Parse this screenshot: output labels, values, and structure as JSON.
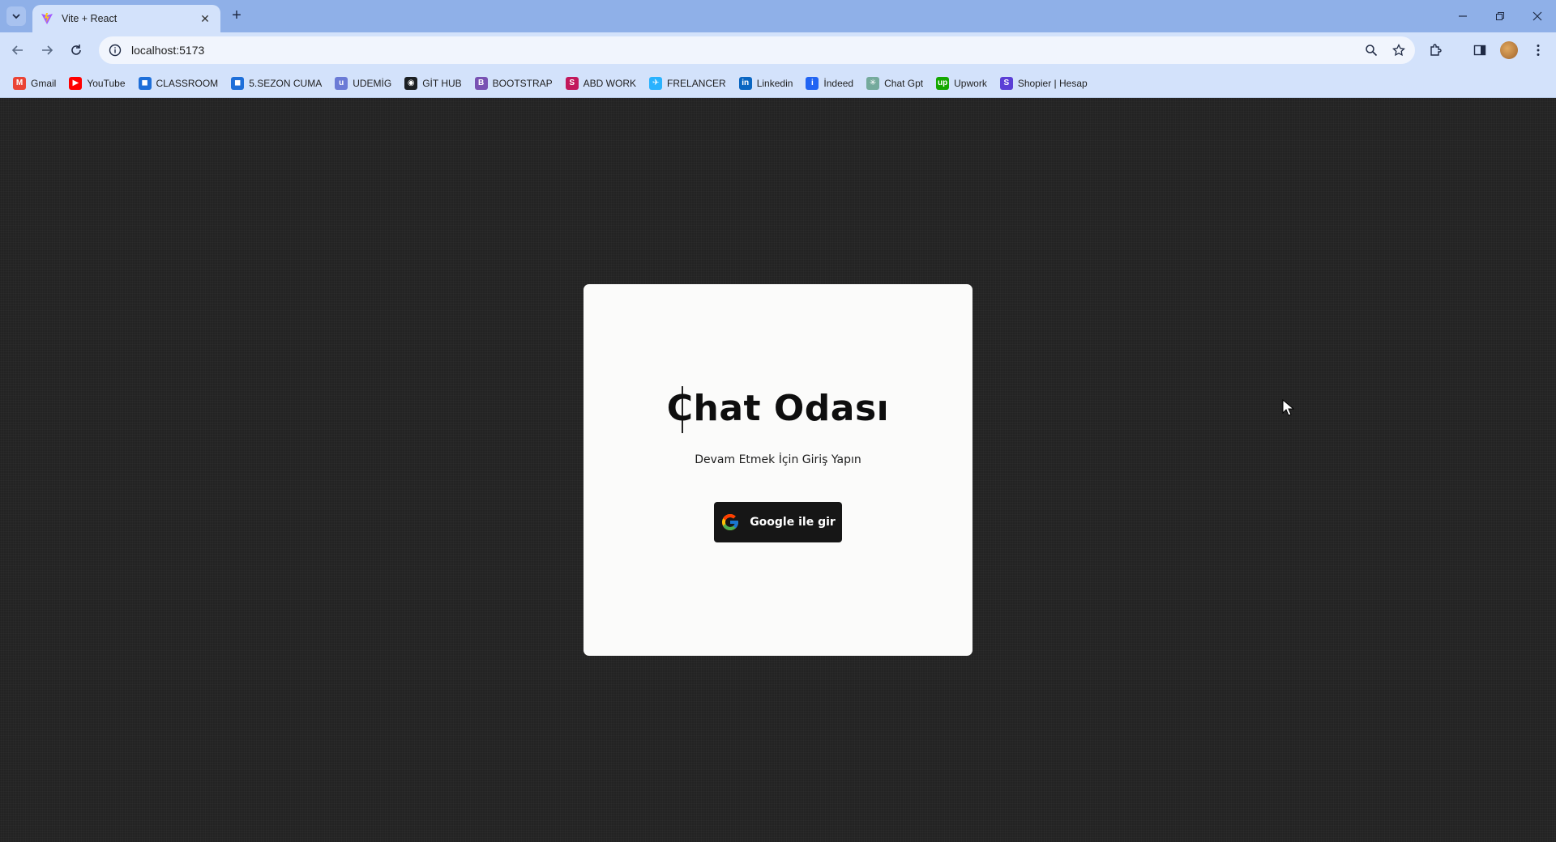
{
  "browser": {
    "tab_title": "Vite + React",
    "url": "localhost:5173"
  },
  "bookmarks": [
    {
      "label": "Gmail",
      "icon": "gmail-icon",
      "color": "#ea4335",
      "glyph": "M"
    },
    {
      "label": "YouTube",
      "icon": "youtube-icon",
      "color": "#ff0000",
      "glyph": "▶"
    },
    {
      "label": "CLASSROOM",
      "icon": "classroom-icon",
      "color": "#1e6fd9",
      "glyph": "◼"
    },
    {
      "label": "5.SEZON CUMA",
      "icon": "classroom-icon",
      "color": "#1e6fd9",
      "glyph": "◼"
    },
    {
      "label": "UDEMİG",
      "icon": "udemig-icon",
      "color": "#6b7bd6",
      "glyph": "u"
    },
    {
      "label": "GİT HUB",
      "icon": "github-icon",
      "color": "#1b1f23",
      "glyph": "◉"
    },
    {
      "label": "BOOTSTRAP",
      "icon": "bootstrap-icon",
      "color": "#7952b3",
      "glyph": "B"
    },
    {
      "label": "ABD WORK",
      "icon": "s-icon",
      "color": "#c2185b",
      "glyph": "S"
    },
    {
      "label": "FRELANCER",
      "icon": "freelancer-icon",
      "color": "#29b2fe",
      "glyph": "✈"
    },
    {
      "label": "Linkedin",
      "icon": "linkedin-icon",
      "color": "#0a66c2",
      "glyph": "in"
    },
    {
      "label": "İndeed",
      "icon": "indeed-icon",
      "color": "#2164f3",
      "glyph": "i"
    },
    {
      "label": "Chat Gpt",
      "icon": "chatgpt-icon",
      "color": "#74aa9c",
      "glyph": "✳"
    },
    {
      "label": "Upwork",
      "icon": "upwork-icon",
      "color": "#14a800",
      "glyph": "up"
    },
    {
      "label": "Shopier | Hesap",
      "icon": "shopier-icon",
      "color": "#5b3fd6",
      "glyph": "S"
    }
  ],
  "login": {
    "title": "Chat Odası",
    "subtitle": "Devam Etmek İçin Giriş Yapın",
    "button_label": "Google ile gir"
  },
  "colors": {
    "page_bg": "#232323",
    "card_bg": "#fbfbfa",
    "button_bg": "#161616",
    "chrome_bg": "#d3e2fb",
    "tabstrip_bg": "#8fb0e8"
  }
}
